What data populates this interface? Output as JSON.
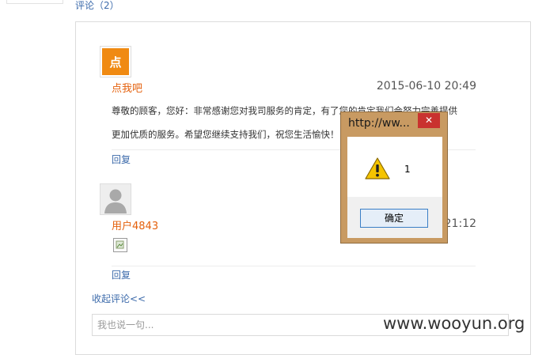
{
  "comments_header": "评论（2）",
  "comments": [
    {
      "avatar_text": "点",
      "username": "点我吧",
      "date": "2015-06-10 20:49",
      "content_lines": [
        "尊敬的顾客，您好：非常感谢您对我司服务的肯定，有了您的肯定我们会努力完善提供",
        "更加优质的服务。希望您继续支持我们，祝您生活愉快！"
      ],
      "reply_label": "回复"
    },
    {
      "username": "用户4843",
      "date": "21:12",
      "reply_label": "回复"
    }
  ],
  "collapse_label": "收起评论<<",
  "comment_input": {
    "placeholder": "我也说一句..."
  },
  "watermark": "www.wooyun.org",
  "alert": {
    "title": "http://ww...",
    "close_symbol": "✕",
    "message": "1",
    "ok_label": "确定"
  },
  "colors": {
    "link": "#3d6bab",
    "username": "#e4600c",
    "dialog_frame": "#c89a62",
    "close_button": "#c9322f"
  }
}
